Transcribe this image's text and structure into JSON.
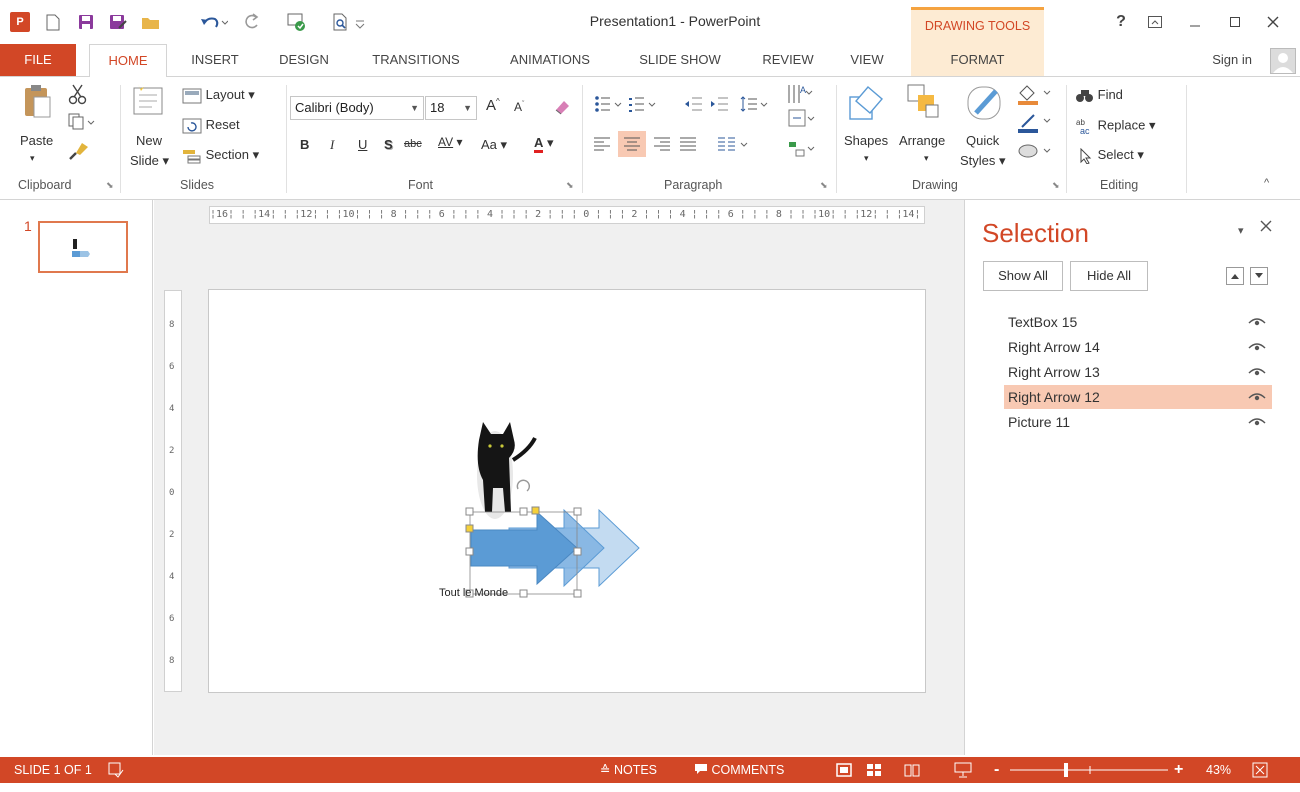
{
  "window": {
    "title": "Presentation1 - PowerPoint",
    "contextual_tab_group": "DRAWING TOOLS",
    "help": "?",
    "app_badge": "P"
  },
  "tabs": {
    "file": "FILE",
    "home": "HOME",
    "insert": "INSERT",
    "design": "DESIGN",
    "transitions": "TRANSITIONS",
    "animations": "ANIMATIONS",
    "slideshow": "SLIDE SHOW",
    "review": "REVIEW",
    "view": "VIEW",
    "format": "FORMAT"
  },
  "signin": "Sign in",
  "ribbon": {
    "clipboard": {
      "label": "Clipboard",
      "paste": "Paste"
    },
    "slides": {
      "label": "Slides",
      "new": "New",
      "slide": "Slide",
      "layout": "Layout",
      "reset": "Reset",
      "section": "Section"
    },
    "font": {
      "label": "Font",
      "name": "Calibri (Body)",
      "size": "18",
      "bold": "B",
      "italic": "I",
      "underline": "U",
      "shadow": "S",
      "strike": "abc",
      "spacing": "AV",
      "case": "Aa",
      "grow": "A",
      "shrink": "A",
      "color": "A"
    },
    "paragraph": {
      "label": "Paragraph"
    },
    "drawing": {
      "label": "Drawing",
      "shapes": "Shapes",
      "arrange": "Arrange",
      "quick": "Quick",
      "styles": "Styles"
    },
    "editing": {
      "label": "Editing",
      "find": "Find",
      "replace": "Replace",
      "select": "Select"
    }
  },
  "thumbnails": {
    "number": "1"
  },
  "ruler": {
    "horizontal": "¦16¦ ¦ ¦14¦ ¦ ¦12¦ ¦ ¦10¦ ¦ ¦ 8 ¦ ¦ ¦ 6 ¦ ¦ ¦ 4 ¦ ¦ ¦ 2 ¦ ¦ ¦ 0 ¦ ¦ ¦ 2 ¦ ¦ ¦ 4 ¦ ¦ ¦ 6 ¦ ¦ ¦ 8 ¦ ¦ ¦10¦ ¦ ¦12¦ ¦ ¦14¦ ¦ ¦16¦",
    "vertical": [
      "8",
      "6",
      "4",
      "2",
      "0",
      "2",
      "4",
      "6",
      "8"
    ]
  },
  "slide": {
    "textbox_text": "Tout le Monde"
  },
  "selection_pane": {
    "title": "Selection",
    "show_all": "Show All",
    "hide_all": "Hide All",
    "items": [
      {
        "name": "TextBox 15"
      },
      {
        "name": "Right Arrow 14"
      },
      {
        "name": "Right Arrow 13"
      },
      {
        "name": "Right Arrow 12",
        "selected": true
      },
      {
        "name": "Picture 11"
      }
    ]
  },
  "status": {
    "slide": "SLIDE 1 OF 1",
    "notes": "NOTES",
    "comments": "COMMENTS",
    "zoom": "43%",
    "minus": "-",
    "plus": "+"
  },
  "colors": {
    "accent": "#d24726",
    "contextual": "#fdebd3",
    "selected_item": "#f8c9b3",
    "arrow": "#5b9bd5"
  }
}
